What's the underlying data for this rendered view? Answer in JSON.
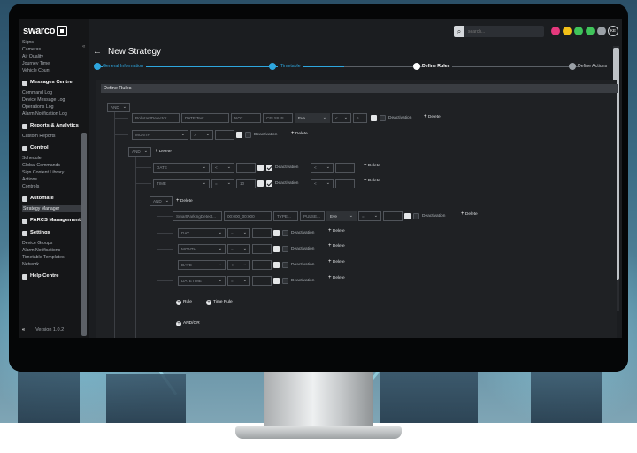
{
  "brand": {
    "logo_text": "swarco"
  },
  "sidebar": {
    "top_items": [
      "Signs",
      "Cameras",
      "Air Quality",
      "Journey Time",
      "Vehicle Count"
    ],
    "sections": [
      {
        "title": "Messages Centre",
        "items": [
          "Command Log",
          "Device Message Log",
          "Operations Log",
          "Alarm Notification Log"
        ]
      },
      {
        "title": "Reports & Analytics",
        "items": [
          "Custom Reports"
        ]
      },
      {
        "title": "Control",
        "items": [
          "Scheduler",
          "Global Commands",
          "Sign Content Library",
          "Actions",
          "Controls"
        ]
      },
      {
        "title": "Automate",
        "items": [
          "Strategy Manager"
        ]
      },
      {
        "title": "PARCS Management",
        "items": []
      },
      {
        "title": "Settings",
        "items": [
          "Device Groups",
          "Alarm Notifications",
          "Timetable Templates",
          "Network"
        ]
      },
      {
        "title": "Help Centre",
        "items": []
      }
    ],
    "active_item": "Strategy Manager",
    "version": "Version 1.0.2",
    "collapse_glyph": "«"
  },
  "topbar": {
    "search_placeholder": "search...",
    "status_dot_colors": [
      "#e5397d",
      "#f2c018",
      "#3fc35a",
      "#3fc35a",
      "#9aa0a6"
    ],
    "avatar_initials": "KE"
  },
  "page": {
    "back_glyph": "←",
    "title": "New Strategy",
    "steps": [
      {
        "label": "General Information",
        "state": "done"
      },
      {
        "label": "Timetable",
        "state": "done"
      },
      {
        "label": "Define Rules",
        "state": "current"
      },
      {
        "label": "Define Actions",
        "state": "pending"
      }
    ]
  },
  "rules": {
    "header": "Define Rules",
    "root_op": "AND",
    "row1": {
      "device": "PollutantDetector",
      "field": "DATE Test",
      "metric": "NO2",
      "unit": "CELSIUS",
      "op": "Eve",
      "cmp": "<",
      "value": "5",
      "deactivation": "Deactivation",
      "delete": "Delete"
    },
    "row2": {
      "field": "MONTH",
      "cmp": ">",
      "deactivation": "Deactivation",
      "delete": "Delete"
    },
    "and2": {
      "op": "AND",
      "delete": "Delete"
    },
    "row3": {
      "field": "DATE",
      "cmp": "<",
      "deactivation": "Deactivation",
      "cmp2": "<",
      "delete": "Delete"
    },
    "row4": {
      "field": "TIME",
      "cmp": "=",
      "value": "10",
      "deactivation": "Deactivation",
      "cmp2": "<",
      "delete": "Delete"
    },
    "and3": {
      "op": "AND",
      "delete": "Delete"
    },
    "row5": {
      "device": "SmartParkingDetect...",
      "value_text": "00:000_00:000",
      "type": "TYPE...",
      "pulse": "PULSE...",
      "op": "Eve",
      "cmp": "=",
      "deactivation": "Deactivation",
      "delete": "Delete"
    },
    "row6": {
      "field": "DAY",
      "cmp": "=",
      "deactivation": "Deactivation",
      "delete": "Delete"
    },
    "row7": {
      "field": "MONTH",
      "cmp": "=",
      "deactivation": "Deactivation",
      "delete": "Delete"
    },
    "row8": {
      "field": "DATE",
      "cmp": "<",
      "deactivation": "Deactivation",
      "delete": "Delete"
    },
    "row9": {
      "field": "DATETIME",
      "cmp": "=",
      "deactivation": "Deactivation",
      "delete": "Delete"
    },
    "add_rule": "Rule",
    "add_time_rule": "Time Rule",
    "add_and_or": "AND/OR"
  }
}
